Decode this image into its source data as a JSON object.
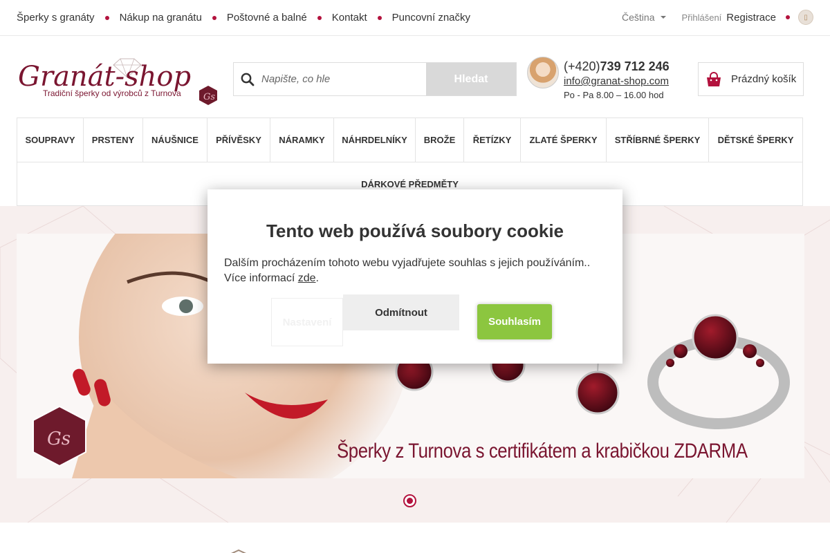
{
  "topnav": {
    "items": [
      "Šperky s granáty",
      "Nákup na granátu",
      "Poštovné a balné",
      "Kontakt",
      "Puncovní značky"
    ],
    "language": "Čeština",
    "login": "Přihlášení",
    "register": "Registrace"
  },
  "header": {
    "logo_text": "Granát-shop",
    "logo_tagline": "Tradiční šperky od výrobců z Turnova",
    "search_placeholder": "Napište, co hle",
    "search_button": "Hledat",
    "phone_prefix": "(+420)",
    "phone_number": "739 712 246",
    "email": "info@granat-shop.com",
    "hours": "Po - Pa 8.00 – 16.00 hod",
    "cart_label": "Prázdný košík"
  },
  "categories": {
    "row1": [
      "SOUPRAVY",
      "PRSTENY",
      "NÁUŠNICE",
      "PŘÍVĚSKY",
      "NÁRAMKY",
      "NÁHRDELNÍKY",
      "BROŽE",
      "ŘETÍZKY",
      "ZLATÉ ŠPERKY",
      "STŘÍBRNÉ ŠPERKY",
      "DĚTSKÉ ŠPERKY"
    ],
    "row2": "DÁRKOVÉ PŘEDMĚTY"
  },
  "banner": {
    "caption": "Šperky z Turnova s certifikátem a krabičkou ZDARMA"
  },
  "cookie_modal": {
    "title": "Tento web používá soubory cookie",
    "text": "Dalším procházením tohoto webu vyjadřujete souhlas s jejich používáním.. Více informací",
    "link": "zde",
    "settings_button": "Nastavení",
    "decline_button": "Odmítnout",
    "accept_button": "Souhlasím"
  },
  "colors": {
    "accent": "#b3123d",
    "accept_green": "#8cc63f",
    "banner_bg": "#f7efee"
  }
}
